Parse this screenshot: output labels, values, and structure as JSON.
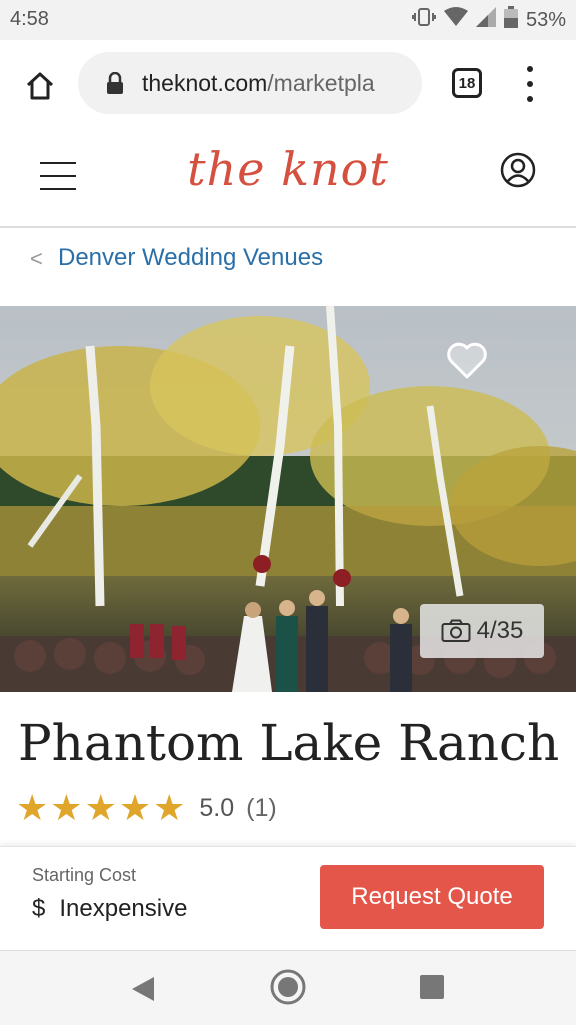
{
  "status": {
    "time": "4:58",
    "battery": "53%"
  },
  "browser": {
    "url_domain": "theknot.com",
    "url_rest": "/marketpla",
    "tab_count": "18"
  },
  "header": {
    "logo": "the knot"
  },
  "breadcrumb": {
    "arrow": "<",
    "label": "Denver Wedding Venues"
  },
  "gallery": {
    "counter": "4/35"
  },
  "venue": {
    "title": "Phantom Lake Ranch",
    "rating_value": "5.0",
    "rating_count": "(1)",
    "stars": 5
  },
  "cost": {
    "label": "Starting Cost",
    "symbol": "$",
    "value": "Inexpensive"
  },
  "cta": {
    "label": "Request Quote"
  },
  "colors": {
    "brand": "#d6503f",
    "link": "#2a6fa8",
    "star": "#dfa62b",
    "button": "#e5564a"
  },
  "icons": [
    "home-icon",
    "lock-icon",
    "tabs-icon",
    "more-icon",
    "hamburger-icon",
    "account-icon",
    "heart-icon",
    "camera-icon",
    "star-icon",
    "back-icon",
    "home-circle-icon",
    "recent-apps-icon"
  ]
}
